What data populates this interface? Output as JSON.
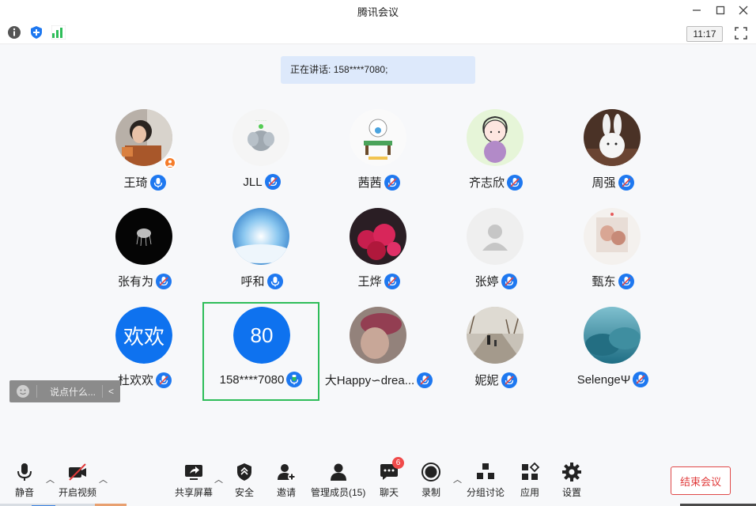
{
  "window": {
    "title": "腾讯会议"
  },
  "top_toolbar": {
    "time": "11:17"
  },
  "speaking_banner": {
    "label": "正在讲话:",
    "value": "158****7080;"
  },
  "participants": [
    {
      "name": "王琦"
    },
    {
      "name": "JLL"
    },
    {
      "name": "茜茜"
    },
    {
      "name": "齐志欣"
    },
    {
      "name": "周强"
    },
    {
      "name": "张有为"
    },
    {
      "name": "呼和"
    },
    {
      "name": "王烨"
    },
    {
      "name": "张婷"
    },
    {
      "name": "甄东"
    },
    {
      "name": "杜欢欢",
      "avatar_text": "欢欢"
    },
    {
      "name": "158****7080",
      "avatar_text": "80"
    },
    {
      "name": "大Happy∽drea..."
    },
    {
      "name": "妮妮"
    },
    {
      "name": "SelengeΨ"
    }
  ],
  "chat_input": {
    "placeholder": "说点什么..."
  },
  "bottom_toolbar": {
    "mute": "静音",
    "video": "开启视频",
    "share": "共享屏幕",
    "security": "安全",
    "invite": "邀请",
    "members": "管理成员(15)",
    "chat": "聊天",
    "chat_badge": "6",
    "record": "录制",
    "breakout": "分组讨论",
    "apps": "应用",
    "settings": "设置",
    "end": "结束会议"
  },
  "colors": {
    "accent": "#0e72ef",
    "active_speaker": "#2ebd59",
    "danger": "#e03a3a",
    "banner": "#dde9fb"
  }
}
